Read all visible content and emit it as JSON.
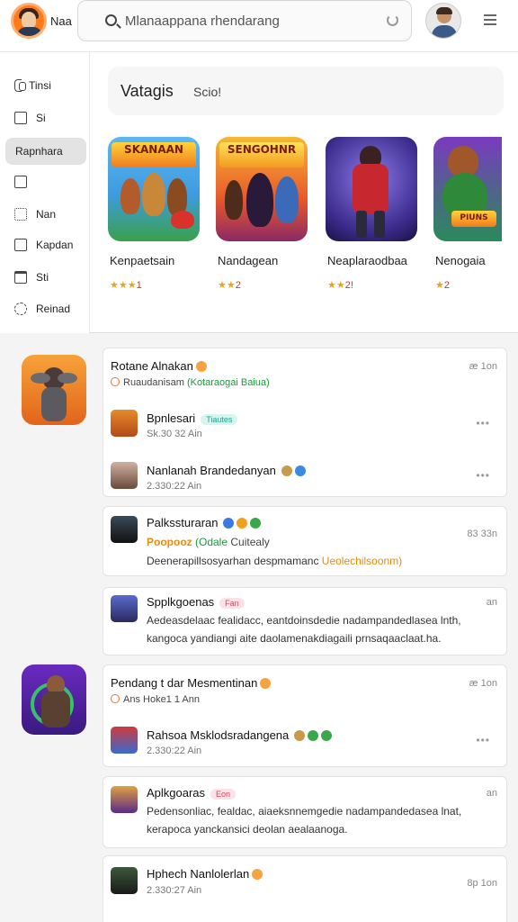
{
  "header": {
    "brand": "Naa",
    "search_placeholder": "Mlanaappana rhendarang"
  },
  "sidebar": {
    "items": [
      {
        "label": "Tinsi",
        "icon": "bracket-icon"
      },
      {
        "label": "Si",
        "icon": "square-icon"
      },
      {
        "label": "Rapnhara",
        "icon": "none",
        "active": true
      },
      {
        "label": "",
        "icon": "square-icon"
      },
      {
        "label": "Nan",
        "icon": "grid-icon"
      },
      {
        "label": "Kapdan",
        "icon": "square-icon"
      },
      {
        "label": "Sti",
        "icon": "calendar-icon"
      },
      {
        "label": "Reinad",
        "icon": "gear-icon"
      }
    ]
  },
  "featured": {
    "title": "Vatagis",
    "subtitle": "Scio!",
    "games": [
      {
        "name": "Kenpaetsain",
        "stars": "★★★",
        "rating": "1",
        "banner": "SKANAAN"
      },
      {
        "name": "Nandagean",
        "stars": "★★",
        "rating": "2",
        "banner": "SENGOHNR"
      },
      {
        "name": "Neaplaraodbaa",
        "stars": "★★",
        "rating": "2!",
        "banner": ""
      },
      {
        "name": "Nenogaia",
        "stars": "★",
        "rating": "2",
        "banner": "PIUNS"
      }
    ]
  },
  "feed": {
    "card1": {
      "title": "Rotane Alnakan",
      "time": "æ 1on",
      "subtitle_a": "Ruaudanisam",
      "subtitle_b": "(Kotaraogai Baiua)",
      "rows": [
        {
          "title": "Bpnlesari",
          "pill": "Tiautes",
          "sub": "Sk.30 32 Ain",
          "dots": "•••"
        },
        {
          "title": "Nanlanah  Brandedanyan",
          "sub": "2.330:22 Ain",
          "dots": "•••"
        }
      ]
    },
    "card2": {
      "title": "Palkssturaran",
      "time": "83 33n",
      "line2_a": "Poopooz",
      "line2_b": "(Odale",
      "line2_c": "Cuitealy",
      "body_a": "Deenerapillsosyarhan despmamanc",
      "body_b": "Ueolechilsoonm)"
    },
    "card3": {
      "title": "Spplkgoenas",
      "pill": "Fan",
      "dots": "an",
      "body": "Aedeasdelaac fealidacc, eantdoinsdedie nadampandedlasea lnth, kangoca yandiangi aite daolamenakdiagaili prnsaqaaclaat.ha."
    },
    "card4": {
      "title": "Pendang t dar Mesmentinan",
      "time": "æ 1on",
      "subtitle": "Ans Hoke1 1 Ann",
      "rows": [
        {
          "title": "Rahsoa Msklodsradangena",
          "sub": "2.330:22 Ain",
          "dots": "•••"
        }
      ]
    },
    "card5": {
      "title": "Aplkgoaras",
      "pill": "Eon",
      "dots": "an",
      "body": "Pedensonliac, fealdac, aiaeksnnemgedie nadampandedasea lnat, kerapoca yanckansici deolan aealaanoga."
    },
    "card6": {
      "title": "Hphech Nanlolerlan",
      "sub": "2.330:27 Ain",
      "time": "8p 1on"
    }
  }
}
